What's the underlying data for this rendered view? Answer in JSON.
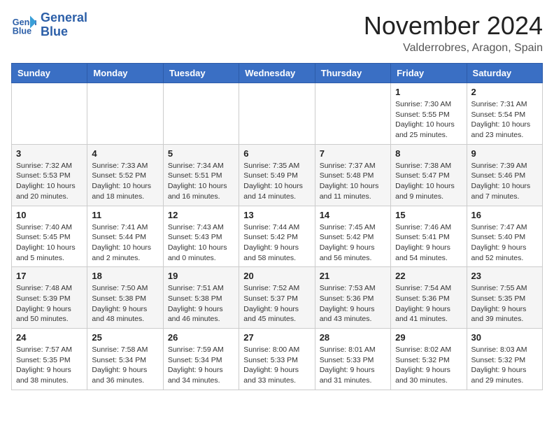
{
  "header": {
    "logo_line1": "General",
    "logo_line2": "Blue",
    "month": "November 2024",
    "location": "Valderrobres, Aragon, Spain"
  },
  "weekdays": [
    "Sunday",
    "Monday",
    "Tuesday",
    "Wednesday",
    "Thursday",
    "Friday",
    "Saturday"
  ],
  "weeks": [
    [
      {
        "day": "",
        "info": ""
      },
      {
        "day": "",
        "info": ""
      },
      {
        "day": "",
        "info": ""
      },
      {
        "day": "",
        "info": ""
      },
      {
        "day": "",
        "info": ""
      },
      {
        "day": "1",
        "info": "Sunrise: 7:30 AM\nSunset: 5:55 PM\nDaylight: 10 hours and 25 minutes."
      },
      {
        "day": "2",
        "info": "Sunrise: 7:31 AM\nSunset: 5:54 PM\nDaylight: 10 hours and 23 minutes."
      }
    ],
    [
      {
        "day": "3",
        "info": "Sunrise: 7:32 AM\nSunset: 5:53 PM\nDaylight: 10 hours and 20 minutes."
      },
      {
        "day": "4",
        "info": "Sunrise: 7:33 AM\nSunset: 5:52 PM\nDaylight: 10 hours and 18 minutes."
      },
      {
        "day": "5",
        "info": "Sunrise: 7:34 AM\nSunset: 5:51 PM\nDaylight: 10 hours and 16 minutes."
      },
      {
        "day": "6",
        "info": "Sunrise: 7:35 AM\nSunset: 5:49 PM\nDaylight: 10 hours and 14 minutes."
      },
      {
        "day": "7",
        "info": "Sunrise: 7:37 AM\nSunset: 5:48 PM\nDaylight: 10 hours and 11 minutes."
      },
      {
        "day": "8",
        "info": "Sunrise: 7:38 AM\nSunset: 5:47 PM\nDaylight: 10 hours and 9 minutes."
      },
      {
        "day": "9",
        "info": "Sunrise: 7:39 AM\nSunset: 5:46 PM\nDaylight: 10 hours and 7 minutes."
      }
    ],
    [
      {
        "day": "10",
        "info": "Sunrise: 7:40 AM\nSunset: 5:45 PM\nDaylight: 10 hours and 5 minutes."
      },
      {
        "day": "11",
        "info": "Sunrise: 7:41 AM\nSunset: 5:44 PM\nDaylight: 10 hours and 2 minutes."
      },
      {
        "day": "12",
        "info": "Sunrise: 7:43 AM\nSunset: 5:43 PM\nDaylight: 10 hours and 0 minutes."
      },
      {
        "day": "13",
        "info": "Sunrise: 7:44 AM\nSunset: 5:42 PM\nDaylight: 9 hours and 58 minutes."
      },
      {
        "day": "14",
        "info": "Sunrise: 7:45 AM\nSunset: 5:42 PM\nDaylight: 9 hours and 56 minutes."
      },
      {
        "day": "15",
        "info": "Sunrise: 7:46 AM\nSunset: 5:41 PM\nDaylight: 9 hours and 54 minutes."
      },
      {
        "day": "16",
        "info": "Sunrise: 7:47 AM\nSunset: 5:40 PM\nDaylight: 9 hours and 52 minutes."
      }
    ],
    [
      {
        "day": "17",
        "info": "Sunrise: 7:48 AM\nSunset: 5:39 PM\nDaylight: 9 hours and 50 minutes."
      },
      {
        "day": "18",
        "info": "Sunrise: 7:50 AM\nSunset: 5:38 PM\nDaylight: 9 hours and 48 minutes."
      },
      {
        "day": "19",
        "info": "Sunrise: 7:51 AM\nSunset: 5:38 PM\nDaylight: 9 hours and 46 minutes."
      },
      {
        "day": "20",
        "info": "Sunrise: 7:52 AM\nSunset: 5:37 PM\nDaylight: 9 hours and 45 minutes."
      },
      {
        "day": "21",
        "info": "Sunrise: 7:53 AM\nSunset: 5:36 PM\nDaylight: 9 hours and 43 minutes."
      },
      {
        "day": "22",
        "info": "Sunrise: 7:54 AM\nSunset: 5:36 PM\nDaylight: 9 hours and 41 minutes."
      },
      {
        "day": "23",
        "info": "Sunrise: 7:55 AM\nSunset: 5:35 PM\nDaylight: 9 hours and 39 minutes."
      }
    ],
    [
      {
        "day": "24",
        "info": "Sunrise: 7:57 AM\nSunset: 5:35 PM\nDaylight: 9 hours and 38 minutes."
      },
      {
        "day": "25",
        "info": "Sunrise: 7:58 AM\nSunset: 5:34 PM\nDaylight: 9 hours and 36 minutes."
      },
      {
        "day": "26",
        "info": "Sunrise: 7:59 AM\nSunset: 5:34 PM\nDaylight: 9 hours and 34 minutes."
      },
      {
        "day": "27",
        "info": "Sunrise: 8:00 AM\nSunset: 5:33 PM\nDaylight: 9 hours and 33 minutes."
      },
      {
        "day": "28",
        "info": "Sunrise: 8:01 AM\nSunset: 5:33 PM\nDaylight: 9 hours and 31 minutes."
      },
      {
        "day": "29",
        "info": "Sunrise: 8:02 AM\nSunset: 5:32 PM\nDaylight: 9 hours and 30 minutes."
      },
      {
        "day": "30",
        "info": "Sunrise: 8:03 AM\nSunset: 5:32 PM\nDaylight: 9 hours and 29 minutes."
      }
    ]
  ]
}
